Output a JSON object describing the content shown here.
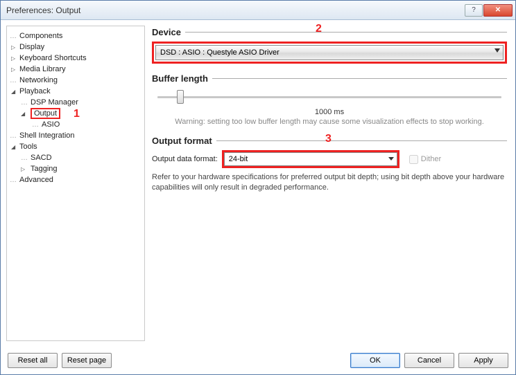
{
  "title": "Preferences: Output",
  "annotations": {
    "one": "1",
    "two": "2",
    "three": "3"
  },
  "tree": {
    "items": [
      {
        "label": "Components",
        "level": 0,
        "expandable": false
      },
      {
        "label": "Display",
        "level": 0,
        "expandable": true
      },
      {
        "label": "Keyboard Shortcuts",
        "level": 0,
        "expandable": true
      },
      {
        "label": "Media Library",
        "level": 0,
        "expandable": true
      },
      {
        "label": "Networking",
        "level": 0,
        "expandable": false
      },
      {
        "label": "Playback",
        "level": 0,
        "expandable": true,
        "expanded": true
      },
      {
        "label": "DSP Manager",
        "level": 1,
        "expandable": false
      },
      {
        "label": "Output",
        "level": 1,
        "expandable": true,
        "expanded": true,
        "selected": true
      },
      {
        "label": "ASIO",
        "level": 2,
        "expandable": false
      },
      {
        "label": "Shell Integration",
        "level": 0,
        "expandable": false
      },
      {
        "label": "Tools",
        "level": 0,
        "expandable": true,
        "expanded": true
      },
      {
        "label": "SACD",
        "level": 1,
        "expandable": false
      },
      {
        "label": "Tagging",
        "level": 1,
        "expandable": true
      },
      {
        "label": "Advanced",
        "level": 0,
        "expandable": false
      }
    ]
  },
  "sections": {
    "device": {
      "title": "Device",
      "value": "DSD : ASIO : Questyle ASIO Driver"
    },
    "buffer": {
      "title": "Buffer length",
      "value_label": "1000 ms",
      "warning": "Warning: setting too low buffer length may cause some visualization effects to stop working."
    },
    "format": {
      "title": "Output format",
      "label": "Output data format:",
      "value": "24-bit",
      "dither_label": "Dither",
      "note": "Refer to your hardware specifications for preferred output bit depth; using bit depth above your hardware capabilities will only result in degraded performance."
    }
  },
  "buttons": {
    "reset_all": "Reset all",
    "reset_page": "Reset page",
    "ok": "OK",
    "cancel": "Cancel",
    "apply": "Apply"
  }
}
